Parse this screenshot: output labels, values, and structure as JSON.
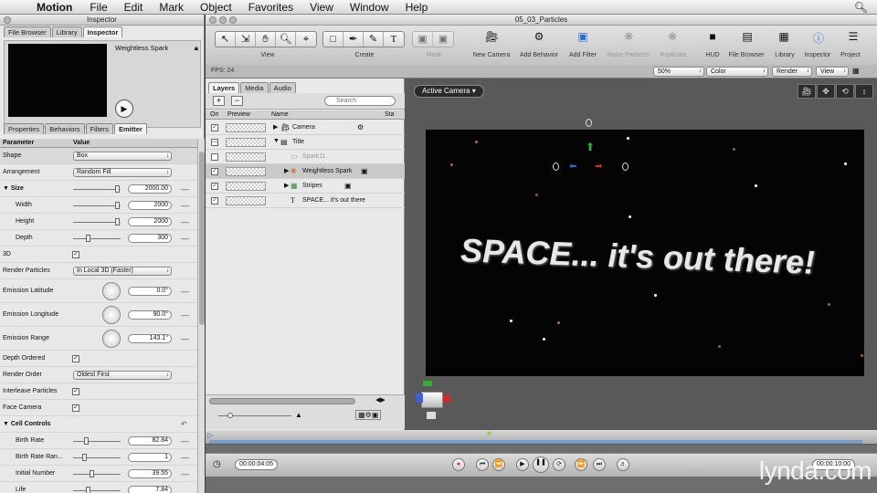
{
  "menubar": {
    "app": "Motion",
    "items": [
      "File",
      "Edit",
      "Mark",
      "Object",
      "Favorites",
      "View",
      "Window",
      "Help"
    ]
  },
  "inspector": {
    "title": "Inspector",
    "top_tabs": [
      "File Browser",
      "Library",
      "Inspector"
    ],
    "preview_name": "Weightless Spark",
    "tabs": [
      "Properties",
      "Behaviors",
      "Filters",
      "Emitter"
    ],
    "col_parameter": "Parameter",
    "col_value": "Value",
    "params": {
      "shape": {
        "label": "Shape",
        "value": "Box"
      },
      "arrangement": {
        "label": "Arrangement",
        "value": "Random Fill"
      },
      "size": {
        "label": "Size",
        "value": "2000.00"
      },
      "width": {
        "label": "Width",
        "value": "2000"
      },
      "height": {
        "label": "Height",
        "value": "2000"
      },
      "depth": {
        "label": "Depth",
        "value": "300"
      },
      "threed": {
        "label": "3D"
      },
      "render_particles": {
        "label": "Render Particles",
        "value": "In Local 3D (Faster)"
      },
      "emission_latitude": {
        "label": "Emission Latitude",
        "value": "0.0°"
      },
      "emission_longitude": {
        "label": "Emission Longitude",
        "value": "90.0°"
      },
      "emission_range": {
        "label": "Emission Range",
        "value": "143.1°"
      },
      "depth_ordered": {
        "label": "Depth Ordered"
      },
      "render_order": {
        "label": "Render Order",
        "value": "Oldest First"
      },
      "interleave": {
        "label": "Interleave Particles"
      },
      "face_camera": {
        "label": "Face Camera"
      },
      "cell_controls": {
        "label": "Cell Controls"
      },
      "birth_rate": {
        "label": "Birth Rate",
        "value": "82.84"
      },
      "birth_rate_ran": {
        "label": "Birth Rate Ran...",
        "value": "1"
      },
      "initial_number": {
        "label": "Initial Number",
        "value": "39.55"
      },
      "life": {
        "label": "Life",
        "value": "7.84"
      }
    }
  },
  "main": {
    "title": "05_03_Particles",
    "toolbar": {
      "view_label": "View",
      "create_label": "Create",
      "mask_label": "Mask",
      "buttons": [
        {
          "label": "New Camera",
          "icon": "camera-icon"
        },
        {
          "label": "Add Behavior",
          "icon": "gear-icon"
        },
        {
          "label": "Add Filter",
          "icon": "filter-icon"
        },
        {
          "label": "Make Particles",
          "icon": "particles-icon",
          "disabled": true
        },
        {
          "label": "Replicate",
          "icon": "replicate-icon",
          "disabled": true
        },
        {
          "label": "HUD",
          "icon": "hud-icon"
        },
        {
          "label": "File Browser",
          "icon": "file-browser-icon"
        },
        {
          "label": "Library",
          "icon": "library-icon"
        },
        {
          "label": "Inspector",
          "icon": "inspector-icon"
        },
        {
          "label": "Project",
          "icon": "project-icon"
        }
      ]
    },
    "status": {
      "fps": "FPS: 24",
      "zoom": "50%",
      "color": "Color",
      "render": "Render",
      "view": "View"
    },
    "layers": {
      "tabs": [
        "Layers",
        "Media",
        "Audio"
      ],
      "search_placeholder": "Search",
      "col_on": "On",
      "col_preview": "Preview",
      "col_name": "Name",
      "col_status": "Sta",
      "rows": [
        {
          "name": "Camera",
          "checked": true,
          "indent": 0
        },
        {
          "name": "Title",
          "checked": true,
          "indent": 0
        },
        {
          "name": "Spark11",
          "checked": false,
          "indent": 1
        },
        {
          "name": "Weightless Spark",
          "checked": true,
          "indent": 1
        },
        {
          "name": "Stripes",
          "checked": true,
          "indent": 1
        },
        {
          "name": "SPACE... it's out there",
          "checked": true,
          "indent": 1
        }
      ]
    },
    "canvas": {
      "camera_button": "Active Camera",
      "stage_text": "SPACE... it's out there!"
    },
    "timeline": {
      "current_time": "00:00:04:05",
      "duration": "00:00:10:00"
    }
  },
  "watermark": "lynda.com"
}
